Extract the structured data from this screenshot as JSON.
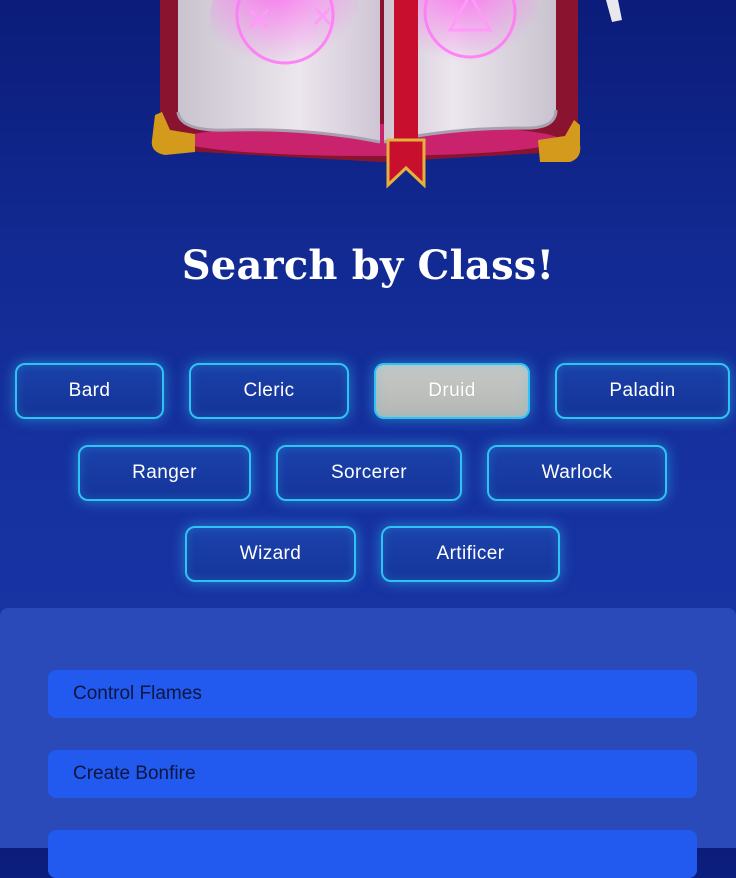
{
  "header": {
    "title": "Search by Class!"
  },
  "classes": [
    {
      "label": "Bard",
      "active": false
    },
    {
      "label": "Cleric",
      "active": false
    },
    {
      "label": "Druid",
      "active": true
    },
    {
      "label": "Paladin",
      "active": false
    },
    {
      "label": "Ranger",
      "active": false
    },
    {
      "label": "Sorcerer",
      "active": false
    },
    {
      "label": "Warlock",
      "active": false
    },
    {
      "label": "Wizard",
      "active": false
    },
    {
      "label": "Artificer",
      "active": false
    }
  ],
  "results": [
    {
      "label": "Control Flames"
    },
    {
      "label": "Create Bonfire"
    },
    {
      "label": ""
    }
  ],
  "colors": {
    "background": "#122a92",
    "button_border": "#2fc3f5",
    "active_button": "#c6c8c6",
    "panel": "#2a4ab9",
    "result_item": "#2259ef"
  }
}
